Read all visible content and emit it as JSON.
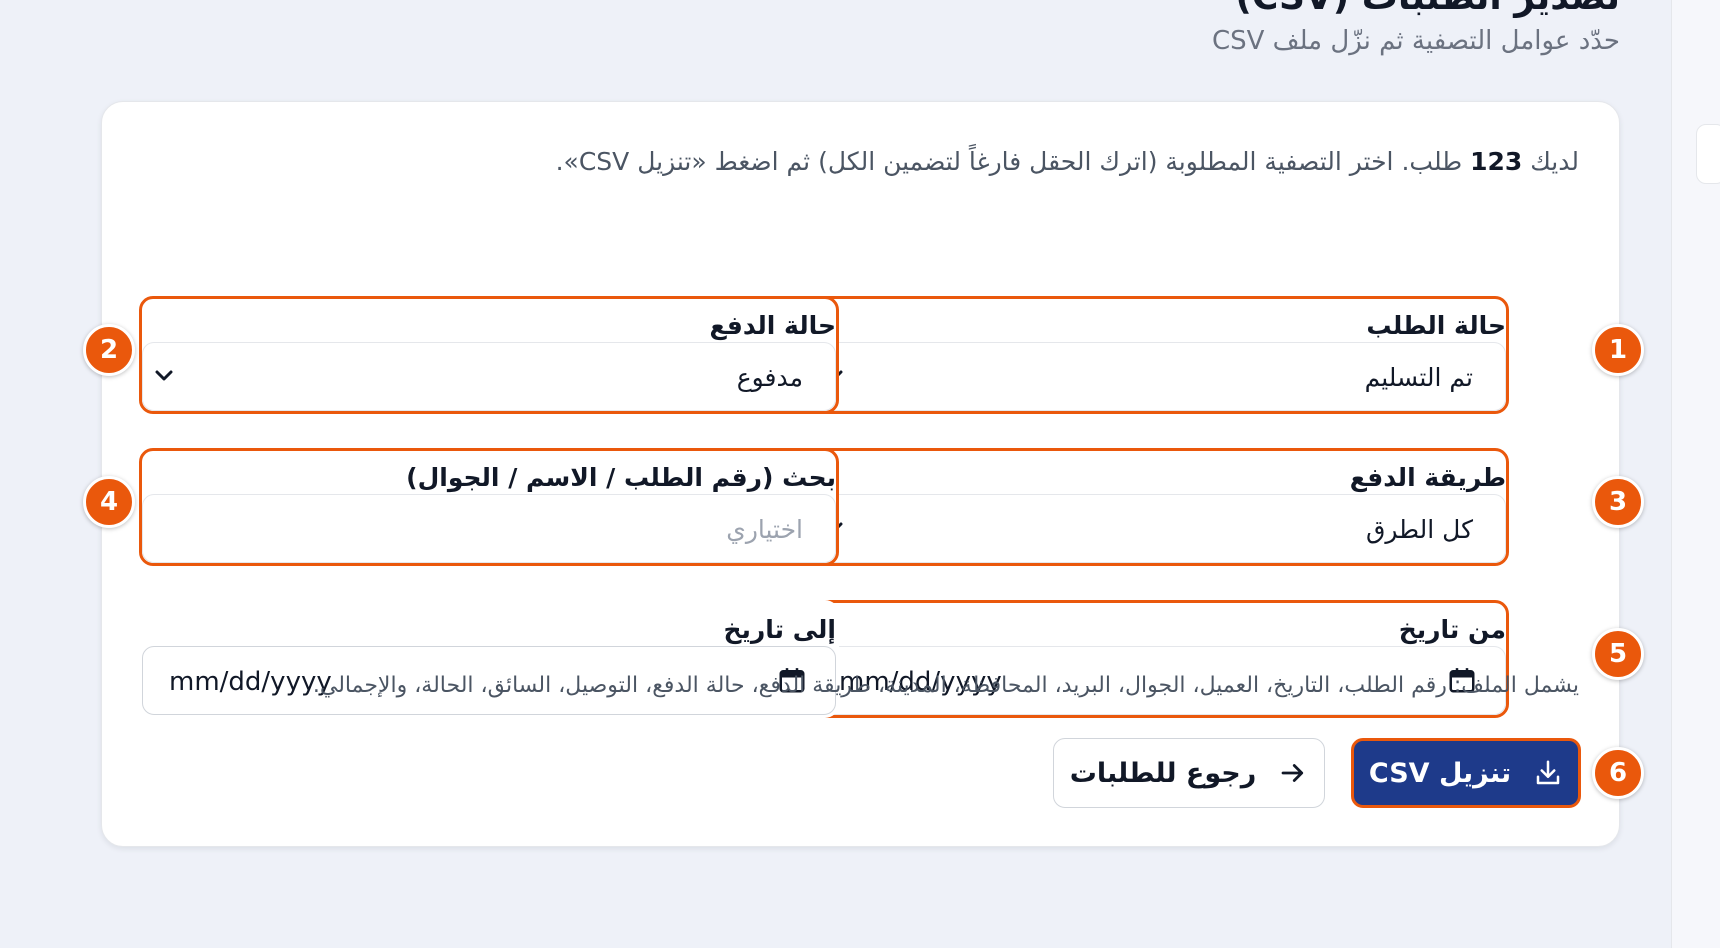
{
  "header": {
    "title": "تصدير الطلبات (CSV)",
    "subtitle": "حدّد عوامل التصفية ثم نزّل ملف CSV"
  },
  "intro": {
    "prefix": "لديك",
    "count": "123",
    "suffix": "طلب. اختر التصفية المطلوبة (اترك الحقل فارغاً لتضمين الكل) ثم اضغط «تنزيل CSV»."
  },
  "filters": {
    "order_status": {
      "label": "حالة الطلب",
      "value": "تم التسليم",
      "badge": "1"
    },
    "payment_status": {
      "label": "حالة الدفع",
      "value": "مدفوع",
      "badge": "2"
    },
    "payment_method": {
      "label": "طريقة الدفع",
      "value": "كل الطرق",
      "badge": "3"
    },
    "search": {
      "label": "بحث (رقم الطلب / الاسم / الجوال)",
      "placeholder": "اختياري",
      "badge": "4"
    },
    "from_date": {
      "label": "من تاريخ",
      "value": "mm/dd/yyyy",
      "badge": "5"
    },
    "to_date": {
      "label": "إلى تاريخ",
      "value": "mm/dd/yyyy"
    }
  },
  "note": "يشمل الملف: رقم الطلب، التاريخ، العميل، الجوال، البريد، المحافظة، المدينة، طريقة الدفع، حالة الدفع، التوصيل، السائق، الحالة، والإجمالي.",
  "actions": {
    "download_label": "تنزيل CSV",
    "download_badge": "6",
    "back_label": "رجوع للطلبات"
  },
  "icons": {
    "download": "download-icon",
    "back": "arrow-right-icon",
    "chevron": "chevron-down-icon",
    "calendar": "calendar-icon"
  },
  "colors": {
    "highlight": "#ea580c",
    "primary": "#1e3a8a",
    "background": "#eef1f8"
  }
}
